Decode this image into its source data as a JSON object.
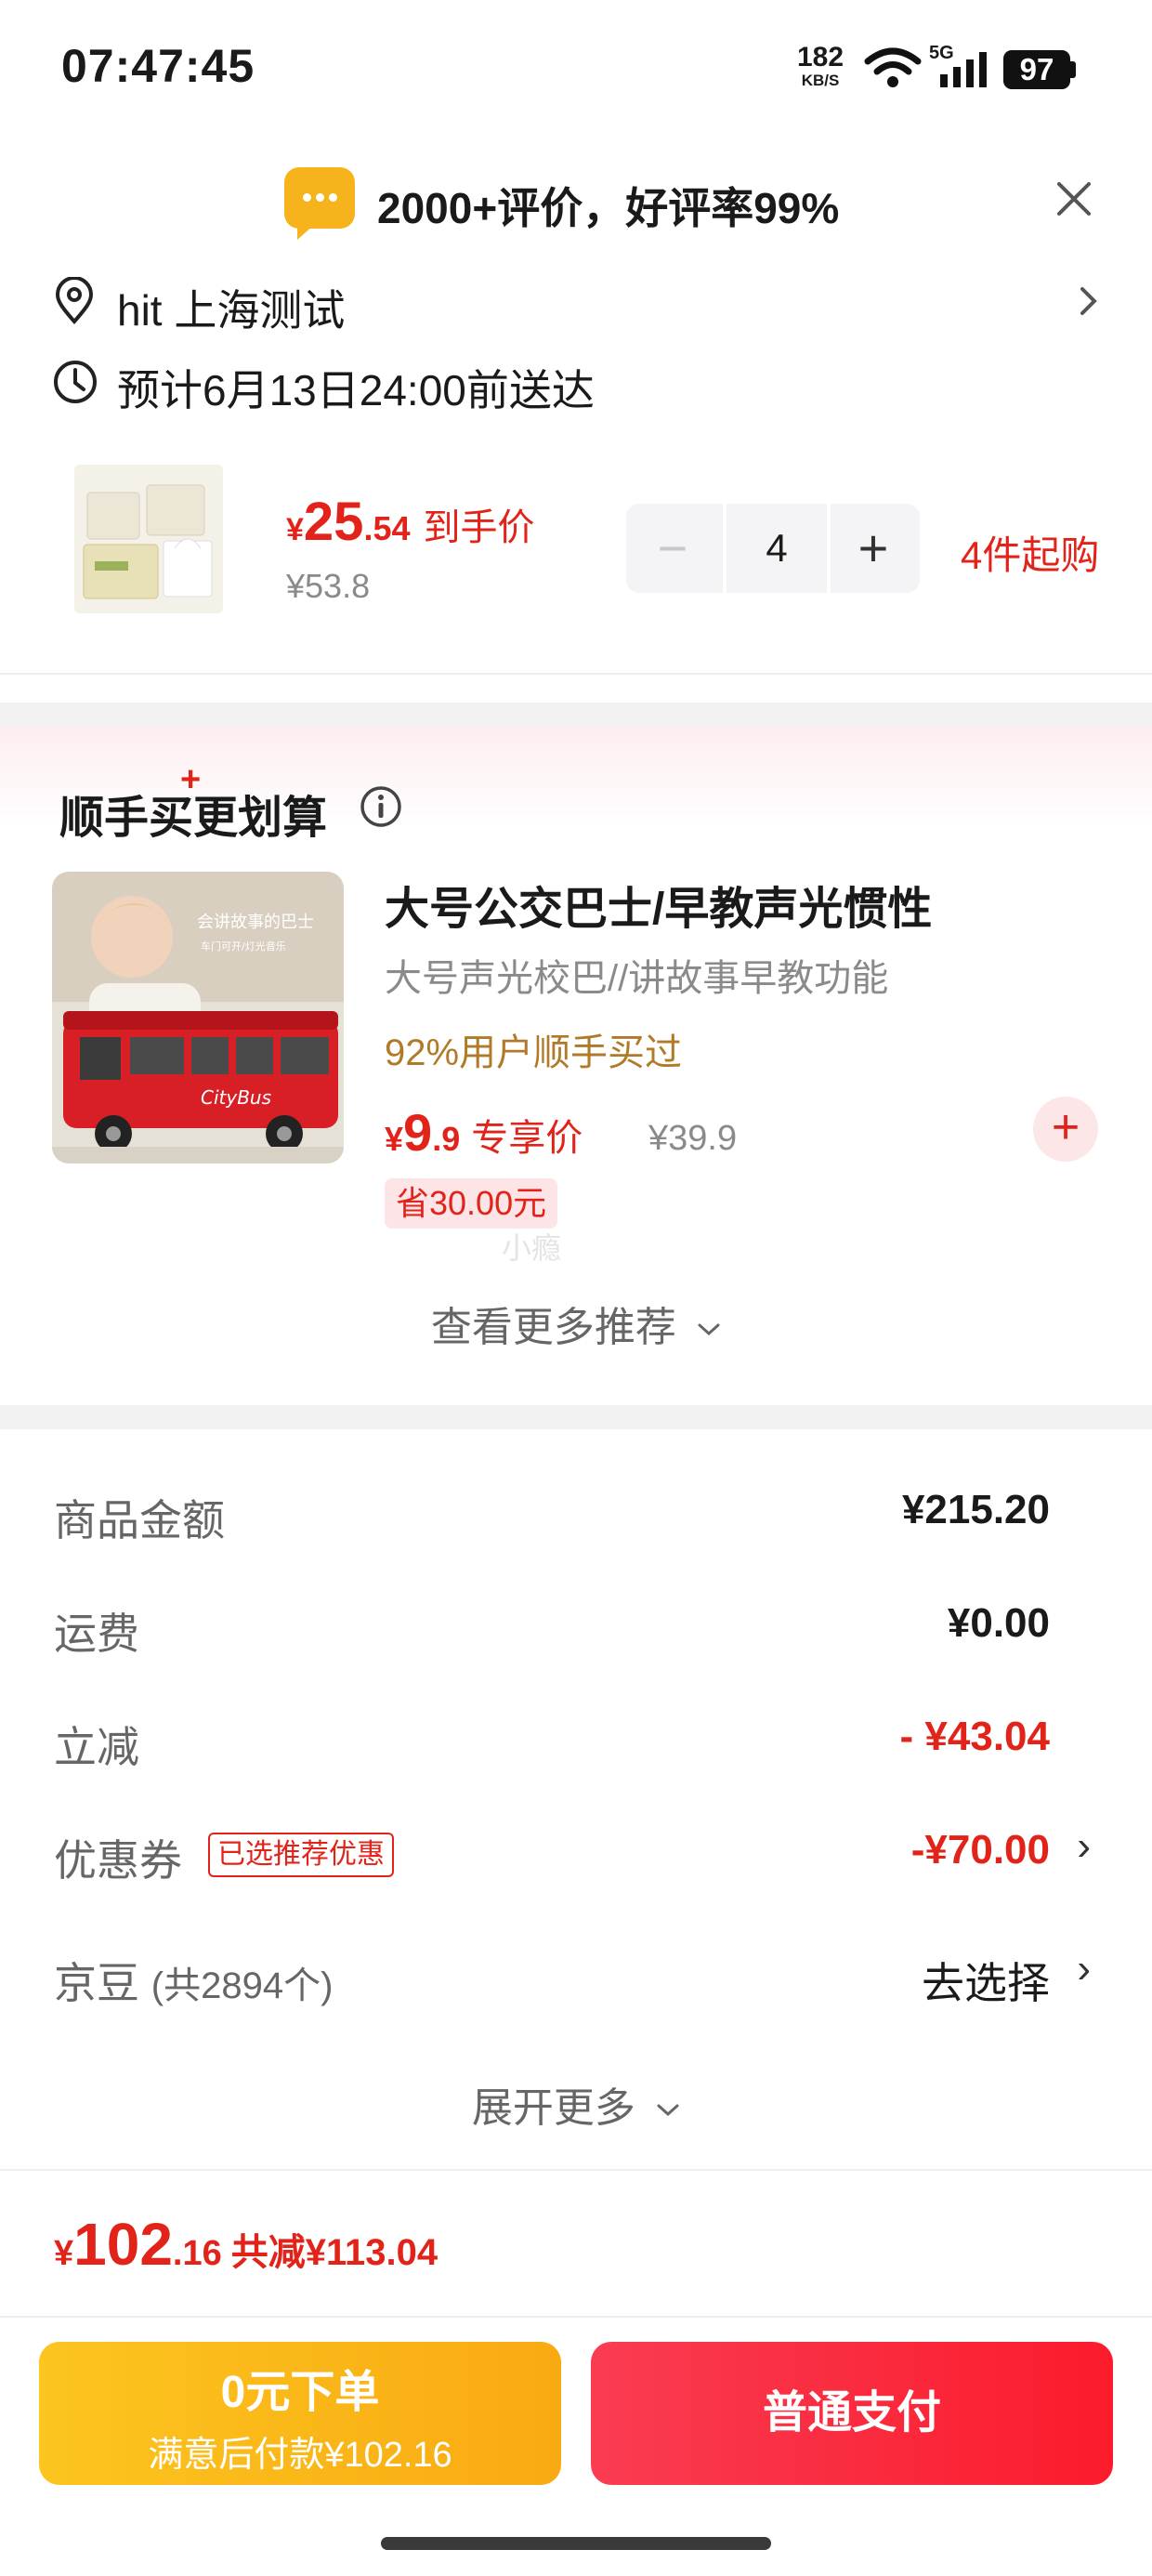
{
  "status_bar": {
    "time": "07:47:45",
    "net_speed_value": "182",
    "net_speed_unit": "KB/S",
    "network_type": "5G",
    "battery": "97"
  },
  "review_banner": {
    "text": "2000+评价，好评率99%"
  },
  "address": {
    "text": "hit  上海测试"
  },
  "delivery": {
    "text": "预计6月13日24:00前送达"
  },
  "product": {
    "price_currency": "¥",
    "price_int": "25",
    "price_dec": ".54",
    "price_label": "到手价",
    "original_price": "¥53.8",
    "quantity": "4",
    "min_buy": "4件起购"
  },
  "recommendation": {
    "title": "顺手买更划算",
    "plus_sign": "+",
    "image_caption": "会讲故事的巴士",
    "image_subcaption": "车门可开/灯光音乐",
    "bus_label": "CityBus",
    "item": {
      "name": "大号公交巴士/早教声光惯性",
      "desc": "大号声光校巴//讲故事早教功能",
      "rate": "92%用户顺手买过",
      "price_currency": "¥",
      "price_int": "9",
      "price_dec": ".9",
      "price_label": "专享价",
      "original_price": "¥39.9",
      "save_tag": "省30.00元"
    },
    "watermark": "小瘾",
    "more_label": "查看更多推荐",
    "add_symbol": "+"
  },
  "summary": {
    "goods_label": "商品金额",
    "goods_value": "¥215.20",
    "shipping_label": "运费",
    "shipping_value": "¥0.00",
    "discount_label": "立减",
    "discount_value": "- ¥43.04",
    "coupon_label": "优惠券",
    "coupon_tag": "已选推荐优惠",
    "coupon_value": "-¥70.00",
    "beans_label": "京豆",
    "beans_count": "(共2894个)",
    "beans_value": "去选择",
    "expand_label": "展开更多",
    "chevron": "›"
  },
  "total": {
    "currency": "¥",
    "int": "102",
    "dec": ".16",
    "saved": "共减¥113.04"
  },
  "buttons": {
    "zero_title": "0元下单",
    "zero_sub": "满意后付款¥102.16",
    "pay": "普通支付"
  },
  "colors": {
    "accent_red": "#e2231a",
    "gold": "#f9aa12"
  }
}
